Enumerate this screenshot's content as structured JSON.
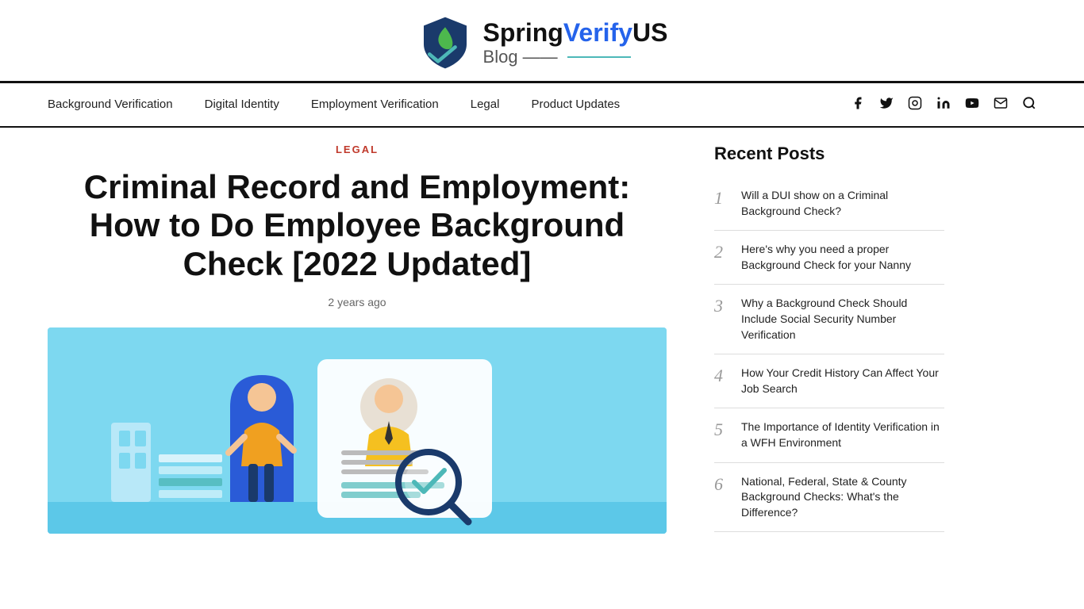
{
  "header": {
    "logo_brand": "SpringVerifyUS",
    "logo_spring": "Spring",
    "logo_verify": "Verify",
    "logo_us": "US",
    "logo_blog": "Blog",
    "logo_line": "——"
  },
  "nav": {
    "links": [
      {
        "label": "Background Verification",
        "href": "#"
      },
      {
        "label": "Digital Identity",
        "href": "#"
      },
      {
        "label": "Employment Verification",
        "href": "#"
      },
      {
        "label": "Legal",
        "href": "#"
      },
      {
        "label": "Product Updates",
        "href": "#"
      }
    ],
    "icons": [
      "facebook",
      "twitter",
      "instagram",
      "linkedin",
      "youtube",
      "email",
      "search"
    ]
  },
  "article": {
    "category": "LEGAL",
    "title": "Criminal Record and Employment: How to Do Employee Background Check [2022 Updated]",
    "meta": "2 years ago"
  },
  "sidebar": {
    "title": "Recent Posts",
    "posts": [
      {
        "number": "1",
        "text": "Will a DUI show on a Criminal Background Check?"
      },
      {
        "number": "2",
        "text": "Here's why you need a proper Background Check for your Nanny"
      },
      {
        "number": "3",
        "text": "Why a Background Check Should Include Social Security Number Verification"
      },
      {
        "number": "4",
        "text": "How Your Credit History Can Affect Your Job Search"
      },
      {
        "number": "5",
        "text": "The Importance of Identity Verification in a WFH Environment"
      },
      {
        "number": "6",
        "text": "National, Federal, State & County Background Checks: What's the Difference?"
      }
    ]
  }
}
